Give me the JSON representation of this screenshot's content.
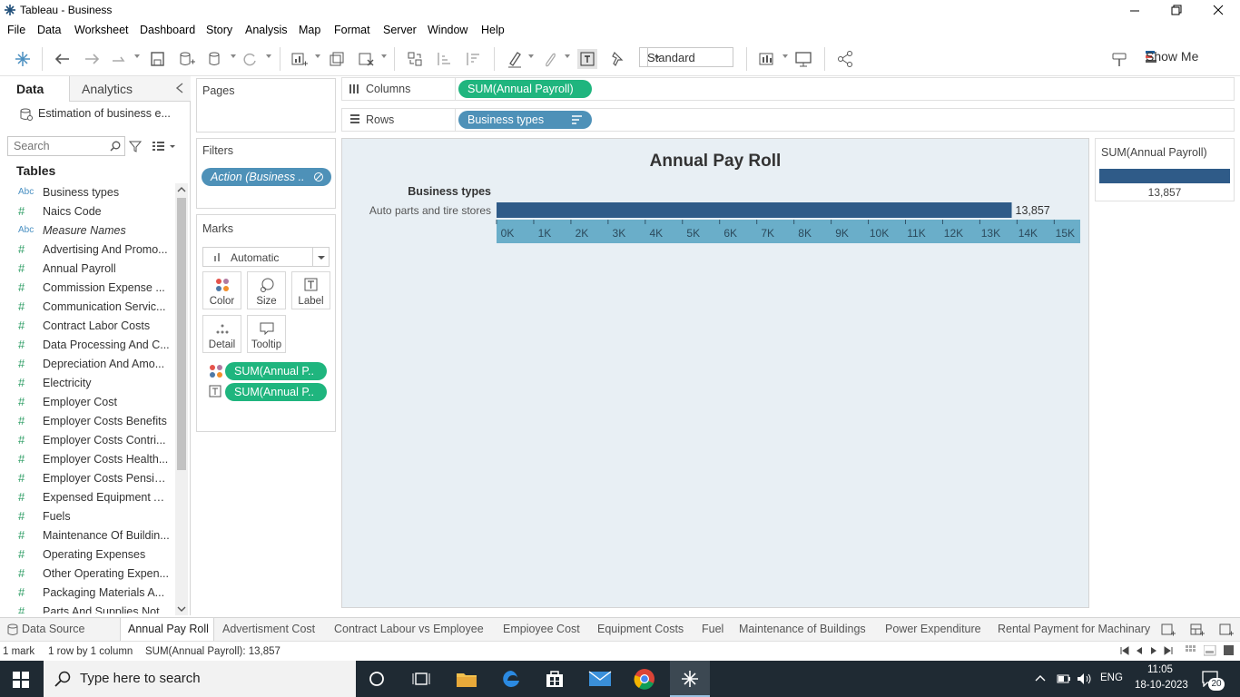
{
  "window": {
    "title": "Tableau - Business"
  },
  "menu": [
    "File",
    "Data",
    "Worksheet",
    "Dashboard",
    "Story",
    "Analysis",
    "Map",
    "Format",
    "Server",
    "Window",
    "Help"
  ],
  "toolbar": {
    "fit_mode": "Standard",
    "show_me": "Show Me"
  },
  "datapane": {
    "tab_data": "Data",
    "tab_analytics": "Analytics",
    "datasource": "Estimation of business e...",
    "search_placeholder": "Search",
    "tables_heading": "Tables",
    "fields": [
      {
        "type": "Abc",
        "name": "Business types"
      },
      {
        "type": "#",
        "name": "Naics Code"
      },
      {
        "type": "Abc",
        "name": "Measure Names",
        "italic": true
      },
      {
        "type": "#",
        "name": "Advertising And Promo..."
      },
      {
        "type": "#",
        "name": "Annual Payroll"
      },
      {
        "type": "#",
        "name": "Commission Expense ..."
      },
      {
        "type": "#",
        "name": "Communication Servic..."
      },
      {
        "type": "#",
        "name": "Contract Labor Costs"
      },
      {
        "type": "#",
        "name": "Data Processing And C..."
      },
      {
        "type": "#",
        "name": "Depreciation And Amo..."
      },
      {
        "type": "#",
        "name": "Electricity"
      },
      {
        "type": "#",
        "name": "Employer Cost"
      },
      {
        "type": "#",
        "name": "Employer Costs Benefits"
      },
      {
        "type": "#",
        "name": "Employer Costs Contri..."
      },
      {
        "type": "#",
        "name": "Employer Costs Health..."
      },
      {
        "type": "#",
        "name": "Employer Costs Pensio..."
      },
      {
        "type": "#",
        "name": "Expensed Equipment A..."
      },
      {
        "type": "#",
        "name": "Fuels"
      },
      {
        "type": "#",
        "name": "Maintenance Of Buildin..."
      },
      {
        "type": "#",
        "name": "Operating Expenses"
      },
      {
        "type": "#",
        "name": "Other Operating Expen..."
      },
      {
        "type": "#",
        "name": "Packaging Materials A..."
      },
      {
        "type": "#",
        "name": "Parts And Supplies Not..."
      }
    ]
  },
  "shelves": {
    "pages": "Pages",
    "filters": "Filters",
    "filter_pill": "Action (Business ..",
    "marks": "Marks",
    "mark_type": "Automatic",
    "mark_buttons": [
      "Color",
      "Size",
      "Label",
      "Detail",
      "Tooltip"
    ],
    "mark_pills": [
      "SUM(Annual P..",
      "SUM(Annual P.."
    ],
    "columns_label": "Columns",
    "columns_pill": "SUM(Annual Payroll)",
    "rows_label": "Rows",
    "rows_pill": "Business types"
  },
  "chart_data": {
    "type": "bar",
    "title": "Annual Pay Roll",
    "row_header": "Business types",
    "categories": [
      "Auto parts and tire stores"
    ],
    "values": [
      13857
    ],
    "data_labels": [
      "13,857"
    ],
    "xlim": [
      0,
      15700
    ],
    "xticks": [
      0,
      1000,
      2000,
      3000,
      4000,
      5000,
      6000,
      7000,
      8000,
      9000,
      10000,
      11000,
      12000,
      13000,
      14000,
      15000
    ],
    "xtick_labels": [
      "0K",
      "1K",
      "2K",
      "3K",
      "4K",
      "5K",
      "6K",
      "7K",
      "8K",
      "9K",
      "10K",
      "11K",
      "12K",
      "13K",
      "14K",
      "15K"
    ],
    "bar_color": "#2f5b88",
    "axis_band_color": "#6aaec9"
  },
  "legend": {
    "title": "SUM(Annual Payroll)",
    "value": "13,857"
  },
  "sheets": {
    "data_source": "Data Source",
    "tabs": [
      "Annual Pay Roll",
      "Advertisment Cost",
      "Contract Labour vs Employee",
      "Empioyee Cost",
      "Equipment Costs",
      "Fuel",
      "Maintenance of Buildings",
      "Power Expenditure",
      "Rental Payment for Machinary"
    ],
    "active": 0
  },
  "status": {
    "marks": "1 mark",
    "rows": "1 row by 1 column",
    "sum": "SUM(Annual Payroll): 13,857"
  },
  "taskbar": {
    "search_placeholder": "Type here to search",
    "lang": "ENG",
    "time": "11:05",
    "date": "18-10-2023",
    "notif": "20"
  }
}
